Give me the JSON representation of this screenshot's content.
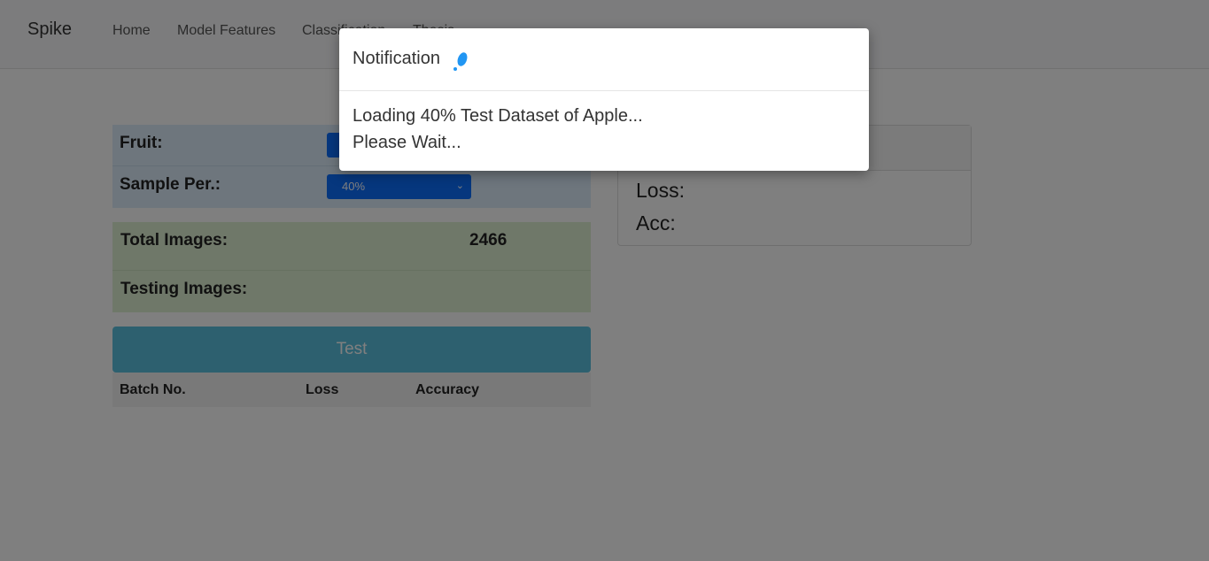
{
  "navbar": {
    "brand": "Spike",
    "links": [
      "Home",
      "Model Features",
      "Classification",
      "Thesis"
    ]
  },
  "params": {
    "fruit_label": "Fruit:",
    "fruit_value": "",
    "sample_label": "Sample Per.:",
    "sample_value": "40%"
  },
  "images": {
    "total_label": "Total Images:",
    "total_value": "2466",
    "testing_label": "Testing Images:",
    "testing_value": ""
  },
  "test_button": "Test",
  "batch_table": {
    "columns": [
      "Batch No.",
      "Loss",
      "Accuracy"
    ]
  },
  "results": {
    "loss_label": "Loss:",
    "acc_label": "Acc:"
  },
  "modal": {
    "title": "Notification",
    "line1": "Loading 40% Test Dataset of Apple...",
    "line2": "Please Wait..."
  },
  "colors": {
    "select_bg": "#0d6efd",
    "test_button_bg": "#5bc0de",
    "spinner": "#2196f3"
  },
  "icons": {
    "spinner": "loading-spinner-icon",
    "select_chevron": "chevron-down-icon"
  }
}
